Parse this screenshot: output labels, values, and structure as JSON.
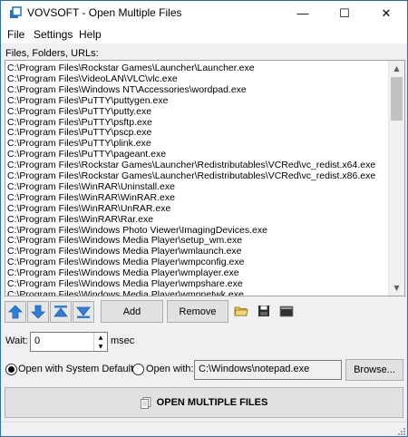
{
  "window": {
    "title": "VOVSOFT - Open Multiple Files"
  },
  "titlebar": {
    "minimize_glyph": "—",
    "maximize_glyph": "☐",
    "close_glyph": "✕"
  },
  "menu": {
    "items": [
      "File",
      "Settings",
      "Help"
    ]
  },
  "files_label": "Files, Folders, URLs:",
  "files": [
    "C:\\Program Files\\Rockstar Games\\Launcher\\Launcher.exe",
    "C:\\Program Files\\VideoLAN\\VLC\\vlc.exe",
    "C:\\Program Files\\Windows NT\\Accessories\\wordpad.exe",
    "C:\\Program Files\\PuTTY\\puttygen.exe",
    "C:\\Program Files\\PuTTY\\putty.exe",
    "C:\\Program Files\\PuTTY\\psftp.exe",
    "C:\\Program Files\\PuTTY\\pscp.exe",
    "C:\\Program Files\\PuTTY\\plink.exe",
    "C:\\Program Files\\PuTTY\\pageant.exe",
    "C:\\Program Files\\Rockstar Games\\Launcher\\Redistributables\\VCRed\\vc_redist.x64.exe",
    "C:\\Program Files\\Rockstar Games\\Launcher\\Redistributables\\VCRed\\vc_redist.x86.exe",
    "C:\\Program Files\\WinRAR\\Uninstall.exe",
    "C:\\Program Files\\WinRAR\\WinRAR.exe",
    "C:\\Program Files\\WinRAR\\UnRAR.exe",
    "C:\\Program Files\\WinRAR\\Rar.exe",
    "C:\\Program Files\\Windows Photo Viewer\\ImagingDevices.exe",
    "C:\\Program Files\\Windows Media Player\\setup_wm.exe",
    "C:\\Program Files\\Windows Media Player\\wmlaunch.exe",
    "C:\\Program Files\\Windows Media Player\\wmpconfig.exe",
    "C:\\Program Files\\Windows Media Player\\wmplayer.exe",
    "C:\\Program Files\\Windows Media Player\\wmpshare.exe",
    "C:\\Program Files\\Windows Media Player\\wmpnetwk.exe"
  ],
  "toolbar": {
    "add_label": "Add",
    "remove_label": "Remove"
  },
  "wait": {
    "label": "Wait:",
    "value": "0",
    "unit": "msec"
  },
  "open_with": {
    "system_defaults_label": "Open with System Defaults",
    "open_with_label": "Open with:",
    "program_path": "C:\\Windows\\notepad.exe",
    "browse_label": "Browse...",
    "selected": "system_defaults"
  },
  "main_button": {
    "label": "OPEN MULTIPLE FILES"
  },
  "colors": {
    "arrow_blue": "#2f7fd8",
    "title_border": "#2b6cb8"
  }
}
